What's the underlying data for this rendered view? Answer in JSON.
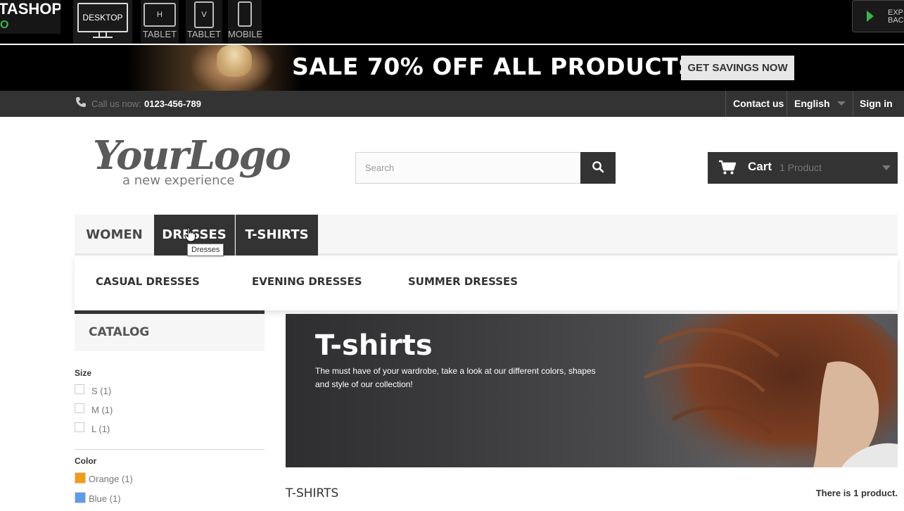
{
  "demo_bar": {
    "brand_line1": "TASHOP",
    "brand_line2": "O",
    "devices": [
      {
        "label": "DESKTOP",
        "icon": "desktop-icon"
      },
      {
        "label": "TABLET",
        "badge": "H",
        "icon": "tablet-horizontal-icon"
      },
      {
        "label": "TABLET",
        "badge": "V",
        "icon": "tablet-vertical-icon"
      },
      {
        "label": "MOBILE",
        "icon": "mobile-icon"
      }
    ],
    "expand_button": "EXP\nBAC"
  },
  "banner": {
    "sale_text": "SALE 70% OFF ALL PRODUCTS",
    "cta": "GET SAVINGS NOW"
  },
  "nav": {
    "call_label": "Call us now:",
    "call_number": "0123-456-789",
    "contact": "Contact us",
    "language": "English",
    "sign_in": "Sign in"
  },
  "header": {
    "logo_script": "YourLogo",
    "logo_tagline": "a new experience",
    "search_placeholder": "Search",
    "cart_label": "Cart",
    "cart_qty": "1 Product"
  },
  "menu": {
    "items": [
      "WOMEN",
      "DRESSES",
      "T-SHIRTS"
    ],
    "submenu": [
      "CASUAL DRESSES",
      "EVENING DRESSES",
      "SUMMER DRESSES"
    ],
    "tooltip": "Dresses"
  },
  "sidebar": {
    "catalog_title": "CATALOG",
    "size_title": "Size",
    "sizes": [
      "S (1)",
      "M (1)",
      "L (1)"
    ],
    "color_title": "Color",
    "colors": [
      {
        "label": "Orange (1)",
        "color": "#f39c11"
      },
      {
        "label": "Blue (1)",
        "color": "#5d9cec"
      }
    ]
  },
  "category": {
    "title": "T-shirts",
    "description": "The must have of your wardrobe, take a look at our different colors, shapes and style of our collection!",
    "heading": "T-SHIRTS",
    "product_count": "There is 1 product."
  },
  "colors": {
    "dark": "#333333",
    "accent_green": "#3bb54a"
  }
}
